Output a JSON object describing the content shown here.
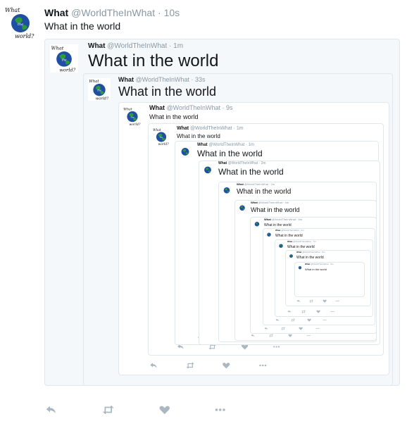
{
  "tweet": {
    "name": "What",
    "handle": "@WorldTheInWhat",
    "separator": "·",
    "time": "10s",
    "text": "What in the world"
  },
  "quotes": [
    {
      "name": "What",
      "handle": "@WorldTheInWhat",
      "separator": "·",
      "time": "1m",
      "text": "What in the world"
    },
    {
      "name": "What",
      "handle": "@WorldTheInWhat",
      "separator": "·",
      "time": "33s",
      "text": "What in the world"
    },
    {
      "name": "What",
      "handle": "@WorldTheInWhat",
      "separator": "·",
      "time": "9s",
      "text": "What in the world"
    },
    {
      "name": "What",
      "handle": "@WorldTheInWhat",
      "separator": "·",
      "time": "1m",
      "text": "What in the world"
    },
    {
      "name": "What",
      "handle": "@WorldTheInWhat",
      "separator": "·",
      "time": "1m",
      "text": "What in the world"
    },
    {
      "name": "What",
      "handle": "@WorldTheInWhat",
      "separator": "·",
      "time": "2m",
      "text": "What in the world"
    },
    {
      "name": "What",
      "handle": "@WorldTheInWhat",
      "separator": "·",
      "time": "2m",
      "text": "What in the world"
    },
    {
      "name": "What",
      "handle": "@WorldTheInWhat",
      "separator": "·",
      "time": "4m",
      "text": "What in the world"
    },
    {
      "name": "What",
      "handle": "@WorldTheInWhat",
      "separator": "·",
      "time": "5m",
      "text": "What in the world"
    },
    {
      "name": "What",
      "handle": "@WorldTheInWhat",
      "separator": "·",
      "time": "6m",
      "text": "What in the world"
    },
    {
      "name": "What",
      "handle": "@WorldTheInWhat",
      "separator": "·",
      "time": "7m",
      "text": "What in the world"
    },
    {
      "name": "What",
      "handle": "@WorldTheInWhat",
      "separator": "·",
      "time": "8m",
      "text": "What in the world"
    },
    {
      "name": "What",
      "handle": "@WorldTheInWhat",
      "separator": "·",
      "time": "8m",
      "text": "What in the world"
    }
  ],
  "actions": {
    "reply_icon": "reply-icon",
    "retweet_icon": "retweet-icon",
    "like_icon": "heart-icon",
    "more_icon": "more-icon"
  },
  "avatar_logo": {
    "top_text": "What",
    "mid_text": "the",
    "bottom_text": "world?"
  },
  "colors": {
    "name": "#14171a",
    "muted": "#8899a6",
    "icon": "#aab8c2",
    "border": "#e1e8ed",
    "quote_bg": "#f5f8fa",
    "globe_blue": "#1e4fa3",
    "globe_green": "#2e9b3a"
  }
}
